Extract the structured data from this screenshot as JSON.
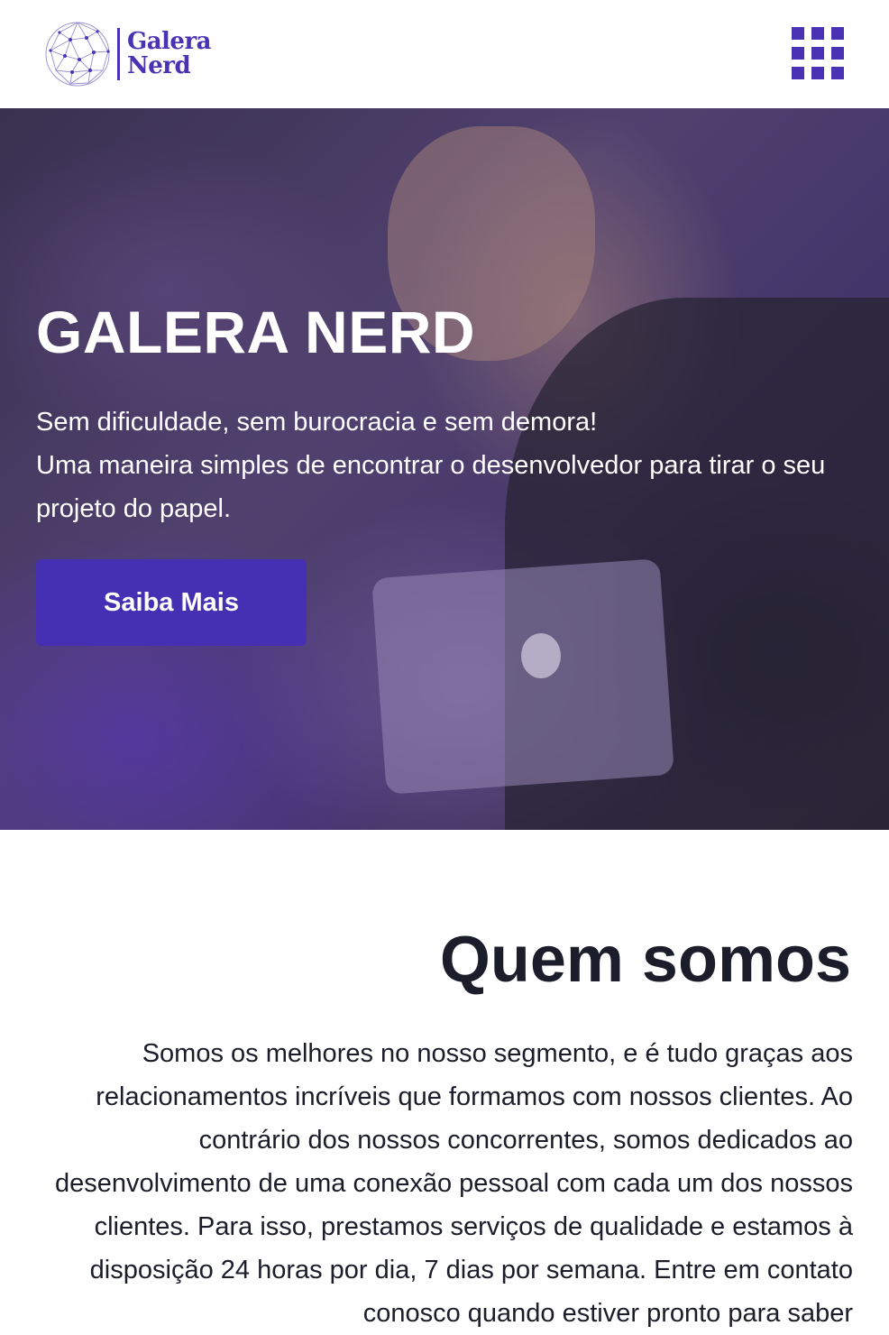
{
  "header": {
    "logo_line1": "Galera",
    "logo_line2": "Nerd",
    "menu_icon": "grid-menu-icon",
    "brand_color": "#4a32b4"
  },
  "hero": {
    "title": "GALERA NERD",
    "text_line1": "Sem dificuldade, sem burocracia e sem demora!",
    "text_line2": "Uma maneira simples de encontrar o desenvolvedor para tirar o seu projeto do papel.",
    "button_label": "Saiba Mais",
    "button_color": "#452fb3"
  },
  "about": {
    "title": "Quem somos",
    "text": "Somos os melhores no nosso segmento, e é tudo graças aos relacionamentos incríveis que formamos com nossos clientes. Ao contrário dos nossos concorrentes, somos dedicados ao desenvolvimento de uma conexão pessoal com cada um dos nossos clientes. Para isso, prestamos serviços de qualidade e estamos à disposição 24 horas por dia, 7 dias por semana. Entre em contato conosco quando estiver pronto para saber"
  }
}
